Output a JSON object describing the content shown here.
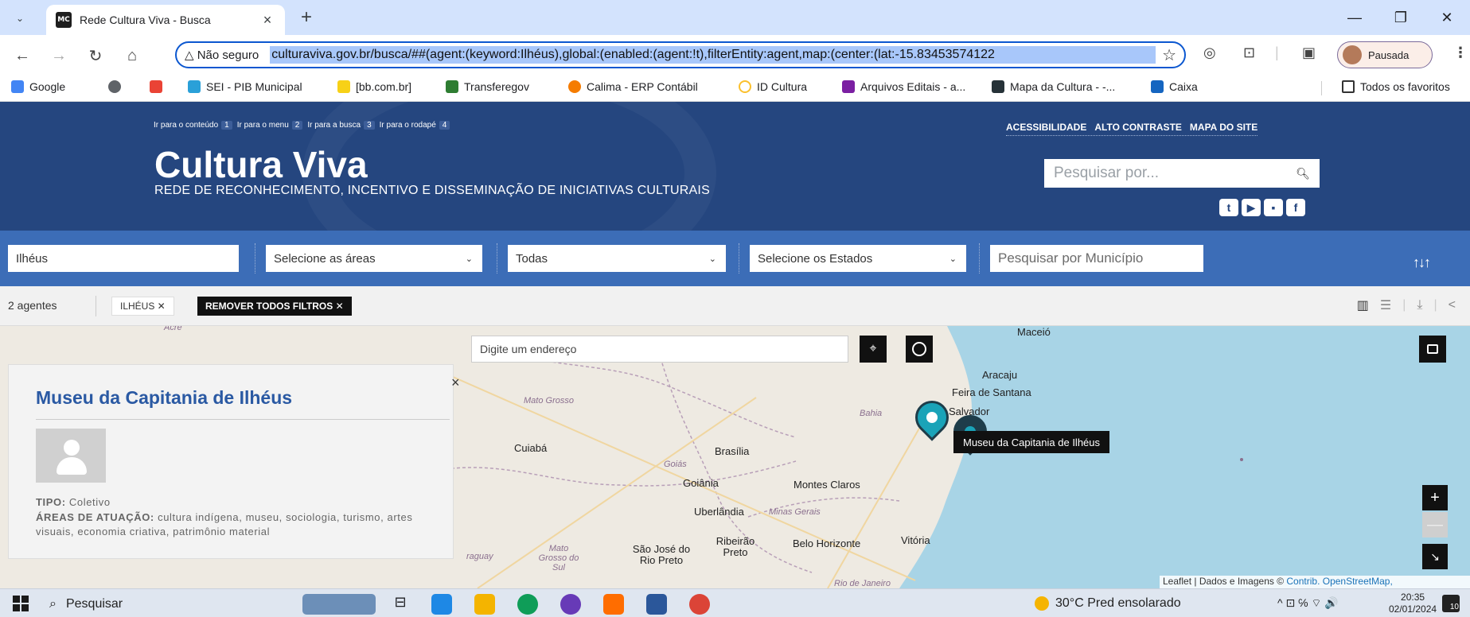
{
  "browser": {
    "tab": {
      "favicon": "MC",
      "title": "Rede Cultura Viva - Busca",
      "close": "×"
    },
    "new_tab": "+",
    "window_controls": {
      "minimize": "—",
      "restore": "❐",
      "close": "✕"
    },
    "security_label": "△ Não seguro",
    "url": "culturaviva.gov.br/busca/##(agent:(keyword:Ilhéus),global:(enabled:(agent:!t),filterEntity:agent,map:(center:(lat:-15.83453574122",
    "profile_label": "Pausada"
  },
  "bookmarks": [
    {
      "label": "Google",
      "color": "#4285f4"
    },
    {
      "label": "",
      "color": "#5f6368"
    },
    {
      "label": "",
      "color": "#ea4335"
    },
    {
      "label": "SEI - PIB Municipal",
      "color": "#2aa0d8"
    },
    {
      "label": "[bb.com.br]",
      "color": "#f7d117"
    },
    {
      "label": "Transferegov",
      "color": "#2e7d32"
    },
    {
      "label": "Calima - ERP Contábil",
      "color": "#f57c00"
    },
    {
      "label": "ID Cultura",
      "color": "#fbc02d"
    },
    {
      "label": "Arquivos Editais - a...",
      "color": "#7b1fa2"
    },
    {
      "label": "Mapa da Cultura - -...",
      "color": "#263238"
    },
    {
      "label": "Caixa",
      "color": "#1565c0"
    }
  ],
  "bookmarks_all": "Todos os favoritos",
  "site": {
    "skip_links": [
      {
        "label": "Ir para o conteúdo",
        "key": "1"
      },
      {
        "label": "Ir para o menu",
        "key": "2"
      },
      {
        "label": "Ir para a busca",
        "key": "3"
      },
      {
        "label": "Ir para o rodapé",
        "key": "4"
      }
    ],
    "header_links": [
      "ACESSIBILIDADE",
      "ALTO CONTRASTE",
      "MAPA DO SITE"
    ],
    "title": "Cultura Viva",
    "subtitle": "REDE DE RECONHECIMENTO, INCENTIVO E DISSEMINAÇÃO DE INICIATIVAS CULTURAIS",
    "search_placeholder": "Pesquisar por...",
    "social": [
      "t",
      "▶",
      "▪",
      "f"
    ]
  },
  "filters": {
    "keyword": "Ilhéus",
    "areas": "Selecione as áreas",
    "type": "Todas",
    "states": "Selecione os Estados",
    "municipio_placeholder": "Pesquisar por Município"
  },
  "results": {
    "count": "2 agentes",
    "chip_keyword": "ILHÉUS ✕",
    "chip_remove_all": "REMOVER TODOS FILTROS ✕"
  },
  "map": {
    "address_placeholder": "Digite um endereço",
    "attribution": "Leaflet | Dados e Imagens © ",
    "attribution_link": "Contrib. OpenStreetMap,",
    "zoom_in": "+",
    "zoom_out": "—",
    "tooltip": "Museu da Capitania de Ilhéus",
    "labels": [
      {
        "text": "Acre",
        "state": true
      },
      {
        "text": "Maceió",
        "state": false
      },
      {
        "text": "Aracaju",
        "state": false
      },
      {
        "text": "Feira de Santana",
        "state": false
      },
      {
        "text": "Salvador",
        "state": false
      },
      {
        "text": "Mato Grosso",
        "state": true
      },
      {
        "text": "Bahia",
        "state": true
      },
      {
        "text": "Cuiabá",
        "state": false
      },
      {
        "text": "Brasília",
        "state": false
      },
      {
        "text": "Goiás",
        "state": true
      },
      {
        "text": "Goiânia",
        "state": false
      },
      {
        "text": "Montes Claros",
        "state": false
      },
      {
        "text": "Uberlândia",
        "state": false
      },
      {
        "text": "Minas Gerais",
        "state": true
      },
      {
        "text": "Mato Grosso do Sul",
        "state": true
      },
      {
        "text": "São José do Rio Preto",
        "state": false
      },
      {
        "text": "Ribeirão Preto",
        "state": false
      },
      {
        "text": "Belo Horizonte",
        "state": false
      },
      {
        "text": "Vitória",
        "state": false
      },
      {
        "text": "raguay",
        "state": true
      },
      {
        "text": "Rio de Janeiro",
        "state": true
      }
    ]
  },
  "popup": {
    "close": "×",
    "title": "Museu da Capitania de Ilhéus",
    "tipo_label": "TIPO:",
    "tipo_value": "Coletivo",
    "areas_label": "ÁREAS DE ATUAÇÃO:",
    "areas_value": "cultura indígena, museu, sociologia, turismo, artes visuais, economia criativa, patrimônio material"
  },
  "taskbar": {
    "search": "Pesquisar",
    "weather": "30°C  Pred ensolarado",
    "tray": "^  ⊡  ℅  ⌔  🔊",
    "time": "20:35",
    "date": "02/01/2024",
    "notif_count": "10"
  }
}
